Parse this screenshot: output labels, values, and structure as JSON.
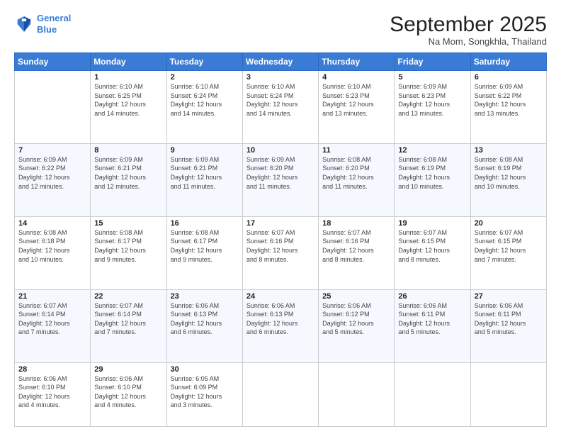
{
  "logo": {
    "line1": "General",
    "line2": "Blue"
  },
  "header": {
    "month": "September 2025",
    "location": "Na Mom, Songkhla, Thailand"
  },
  "weekdays": [
    "Sunday",
    "Monday",
    "Tuesday",
    "Wednesday",
    "Thursday",
    "Friday",
    "Saturday"
  ],
  "weeks": [
    [
      {
        "day": "",
        "info": ""
      },
      {
        "day": "1",
        "info": "Sunrise: 6:10 AM\nSunset: 6:25 PM\nDaylight: 12 hours\nand 14 minutes."
      },
      {
        "day": "2",
        "info": "Sunrise: 6:10 AM\nSunset: 6:24 PM\nDaylight: 12 hours\nand 14 minutes."
      },
      {
        "day": "3",
        "info": "Sunrise: 6:10 AM\nSunset: 6:24 PM\nDaylight: 12 hours\nand 14 minutes."
      },
      {
        "day": "4",
        "info": "Sunrise: 6:10 AM\nSunset: 6:23 PM\nDaylight: 12 hours\nand 13 minutes."
      },
      {
        "day": "5",
        "info": "Sunrise: 6:09 AM\nSunset: 6:23 PM\nDaylight: 12 hours\nand 13 minutes."
      },
      {
        "day": "6",
        "info": "Sunrise: 6:09 AM\nSunset: 6:22 PM\nDaylight: 12 hours\nand 13 minutes."
      }
    ],
    [
      {
        "day": "7",
        "info": "Sunrise: 6:09 AM\nSunset: 6:22 PM\nDaylight: 12 hours\nand 12 minutes."
      },
      {
        "day": "8",
        "info": "Sunrise: 6:09 AM\nSunset: 6:21 PM\nDaylight: 12 hours\nand 12 minutes."
      },
      {
        "day": "9",
        "info": "Sunrise: 6:09 AM\nSunset: 6:21 PM\nDaylight: 12 hours\nand 11 minutes."
      },
      {
        "day": "10",
        "info": "Sunrise: 6:09 AM\nSunset: 6:20 PM\nDaylight: 12 hours\nand 11 minutes."
      },
      {
        "day": "11",
        "info": "Sunrise: 6:08 AM\nSunset: 6:20 PM\nDaylight: 12 hours\nand 11 minutes."
      },
      {
        "day": "12",
        "info": "Sunrise: 6:08 AM\nSunset: 6:19 PM\nDaylight: 12 hours\nand 10 minutes."
      },
      {
        "day": "13",
        "info": "Sunrise: 6:08 AM\nSunset: 6:19 PM\nDaylight: 12 hours\nand 10 minutes."
      }
    ],
    [
      {
        "day": "14",
        "info": "Sunrise: 6:08 AM\nSunset: 6:18 PM\nDaylight: 12 hours\nand 10 minutes."
      },
      {
        "day": "15",
        "info": "Sunrise: 6:08 AM\nSunset: 6:17 PM\nDaylight: 12 hours\nand 9 minutes."
      },
      {
        "day": "16",
        "info": "Sunrise: 6:08 AM\nSunset: 6:17 PM\nDaylight: 12 hours\nand 9 minutes."
      },
      {
        "day": "17",
        "info": "Sunrise: 6:07 AM\nSunset: 6:16 PM\nDaylight: 12 hours\nand 8 minutes."
      },
      {
        "day": "18",
        "info": "Sunrise: 6:07 AM\nSunset: 6:16 PM\nDaylight: 12 hours\nand 8 minutes."
      },
      {
        "day": "19",
        "info": "Sunrise: 6:07 AM\nSunset: 6:15 PM\nDaylight: 12 hours\nand 8 minutes."
      },
      {
        "day": "20",
        "info": "Sunrise: 6:07 AM\nSunset: 6:15 PM\nDaylight: 12 hours\nand 7 minutes."
      }
    ],
    [
      {
        "day": "21",
        "info": "Sunrise: 6:07 AM\nSunset: 6:14 PM\nDaylight: 12 hours\nand 7 minutes."
      },
      {
        "day": "22",
        "info": "Sunrise: 6:07 AM\nSunset: 6:14 PM\nDaylight: 12 hours\nand 7 minutes."
      },
      {
        "day": "23",
        "info": "Sunrise: 6:06 AM\nSunset: 6:13 PM\nDaylight: 12 hours\nand 6 minutes."
      },
      {
        "day": "24",
        "info": "Sunrise: 6:06 AM\nSunset: 6:13 PM\nDaylight: 12 hours\nand 6 minutes."
      },
      {
        "day": "25",
        "info": "Sunrise: 6:06 AM\nSunset: 6:12 PM\nDaylight: 12 hours\nand 5 minutes."
      },
      {
        "day": "26",
        "info": "Sunrise: 6:06 AM\nSunset: 6:11 PM\nDaylight: 12 hours\nand 5 minutes."
      },
      {
        "day": "27",
        "info": "Sunrise: 6:06 AM\nSunset: 6:11 PM\nDaylight: 12 hours\nand 5 minutes."
      }
    ],
    [
      {
        "day": "28",
        "info": "Sunrise: 6:06 AM\nSunset: 6:10 PM\nDaylight: 12 hours\nand 4 minutes."
      },
      {
        "day": "29",
        "info": "Sunrise: 6:06 AM\nSunset: 6:10 PM\nDaylight: 12 hours\nand 4 minutes."
      },
      {
        "day": "30",
        "info": "Sunrise: 6:05 AM\nSunset: 6:09 PM\nDaylight: 12 hours\nand 3 minutes."
      },
      {
        "day": "",
        "info": ""
      },
      {
        "day": "",
        "info": ""
      },
      {
        "day": "",
        "info": ""
      },
      {
        "day": "",
        "info": ""
      }
    ]
  ]
}
